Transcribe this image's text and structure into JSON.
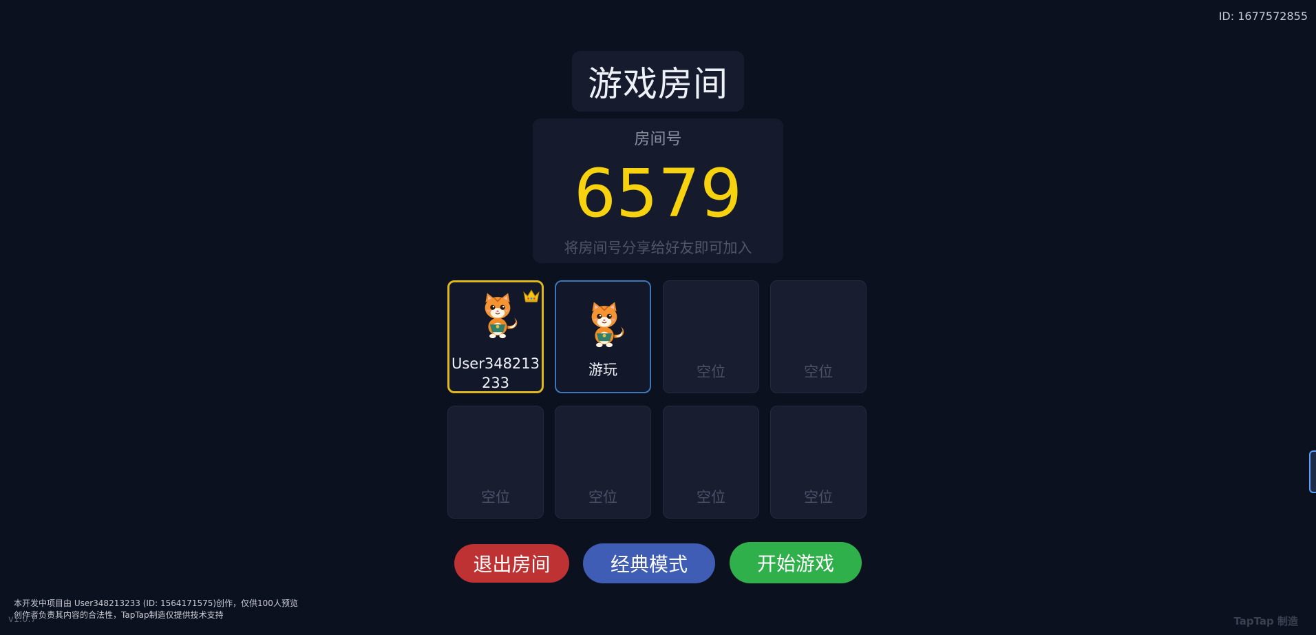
{
  "header": {
    "user_id": "ID: 1677572855"
  },
  "room": {
    "title": "游戏房间",
    "label": "房间号",
    "number": "6579",
    "hint": "将房间号分享给好友即可加入"
  },
  "slots": {
    "host": {
      "name_line1": "User348213",
      "name_line2": "233",
      "icon": "cat-avatar-icon",
      "badge": "crown-icon"
    },
    "player": {
      "name": "游玩",
      "icon": "cat-avatar-icon"
    },
    "empty_label": "空位"
  },
  "buttons": {
    "exit": "退出房间",
    "mode": "经典模式",
    "start": "开始游戏"
  },
  "footer": {
    "notice_line1": "本开发中项目由 User348213233 (ID: 1564171575)创作，仅供100人预览",
    "notice_line2": "创作者负责其内容的合法性，TapTap制造仅提供技术支持",
    "version": "v1.0.7",
    "brand": "TapTap 制造"
  },
  "colors": {
    "background": "#0c1120",
    "room_number": "#f7d20f",
    "host_border": "#e0b81c",
    "player_border": "#3c78b8",
    "exit_button": "#be3233",
    "mode_button": "#3f5db5",
    "start_button": "#2fb04b"
  }
}
